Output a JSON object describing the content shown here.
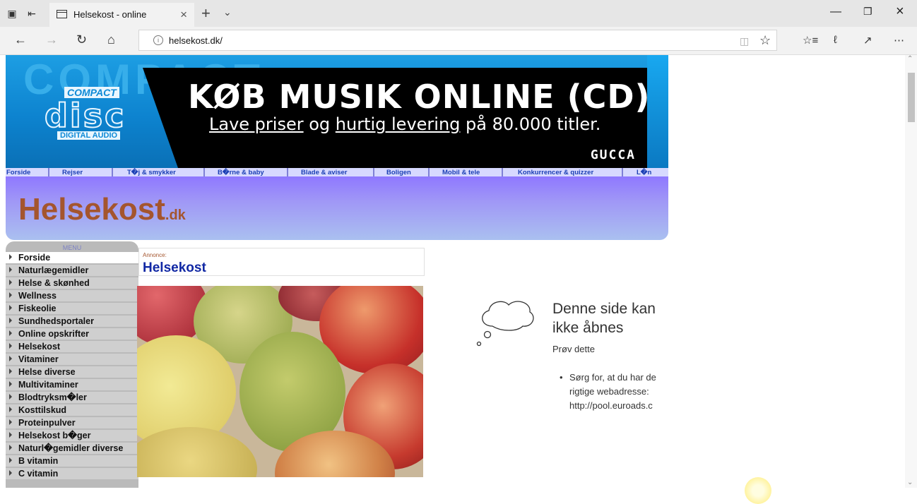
{
  "browser": {
    "tab_title": "Helsekost - online",
    "url": "helsekost.dk/"
  },
  "banner": {
    "bg_text": "COMPACT",
    "cd_compact": "COMPACT",
    "cd_disc": "disc",
    "cd_digital": "DIGITAL AUDIO",
    "headline": "KØB MUSIK ONLINE (CD)",
    "sub_a": "Lave priser",
    "sub_b": " og ",
    "sub_c": "hurtig levering",
    "sub_d": " på 80.000 titler.",
    "brand": "GUCCA"
  },
  "catnav": {
    "items": [
      "Forside",
      "Rejser",
      "T�j & smykker",
      "B�rne & baby",
      "Blade & aviser",
      "Boligen",
      "Mobil & tele",
      "Konkurrencer & quizzer",
      "L�n"
    ]
  },
  "logo": {
    "main": "Helsekost",
    "tld": ".dk"
  },
  "menu": {
    "title": "MENU",
    "items": [
      "Forside",
      "Naturlægemidler",
      "Helse & skønhed",
      "Wellness",
      "Fiskeolie",
      "Sundhedsportaler",
      "Online opskrifter",
      "Helsekost",
      "Vitaminer",
      "Helse diverse",
      "Multivitaminer",
      "Blodtryksm�ler",
      "Kosttilskud",
      "Proteinpulver",
      "Helsekost b�ger",
      "Naturl�gemidler diverse",
      "B vitamin",
      "C vitamin"
    ]
  },
  "ad": {
    "label": "Annonce:",
    "title": "Helsekost"
  },
  "error": {
    "title": "Denne side kan ikke åbnes",
    "try": "Prøv dette",
    "bullet_line1": "Sørg for, at du har de",
    "bullet_line2": "rigtige webadresse:",
    "bullet_line3": "http://pool.euroads.c"
  },
  "colors": {
    "menu_link": "#1a3fb4",
    "logo": "#a4552e",
    "ad_title": "#1128a4",
    "banner_blue": "#0d83cf"
  }
}
